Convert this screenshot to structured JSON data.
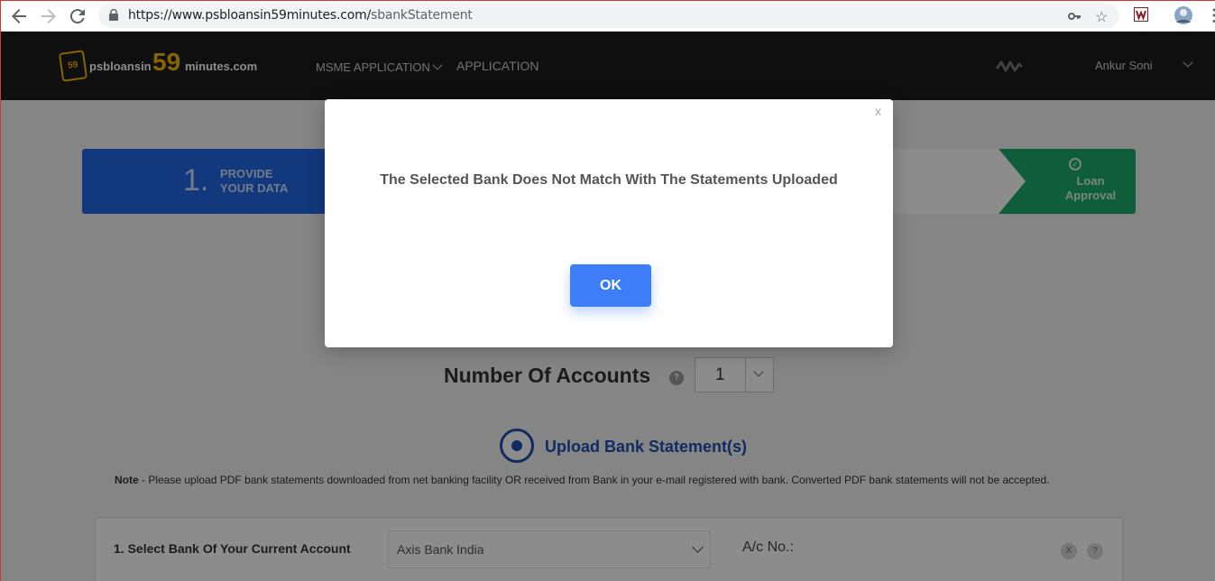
{
  "browser": {
    "url_domain": "https://www.psbloansin59minutes.com/",
    "url_path": "sbankStatement"
  },
  "site": {
    "logo_badge": "59",
    "logo_text_a": "psbloansin",
    "logo_text_59": "59",
    "logo_text_b": "minutes.com",
    "menu": [
      {
        "label": "MSME APPLICATION"
      },
      {
        "label": "APPLICATION"
      }
    ],
    "user_name": "Ankur Soni"
  },
  "steps": {
    "first_number": "1.",
    "first_label": "PROVIDE\nYOUR DATA",
    "last_label": "Loan\nApproval"
  },
  "accounts": {
    "label": "Number Of Accounts",
    "help": "?",
    "value": "1"
  },
  "upload": {
    "title": "Upload Bank Statement(s)",
    "note_bold": "Note",
    "note_text": " - Please upload PDF bank statements downloaded from net banking facility OR received from Bank in your e-mail registered with bank. Converted PDF bank statements will not be accepted."
  },
  "bank_card": {
    "label": "1. Select Bank Of Your Current Account",
    "selected_bank": "Axis Bank India",
    "acno_label": "A/c No.:",
    "remove": "X",
    "help": "?"
  },
  "modal": {
    "close": "x",
    "message": "The Selected Bank Does Not Match With The Statements Uploaded",
    "ok_label": "OK"
  },
  "colors": {
    "primary_blue": "#2266e3",
    "ok_button": "#3e7df8",
    "success_green": "#1eaa6e",
    "logo_gold": "#f5b700"
  }
}
